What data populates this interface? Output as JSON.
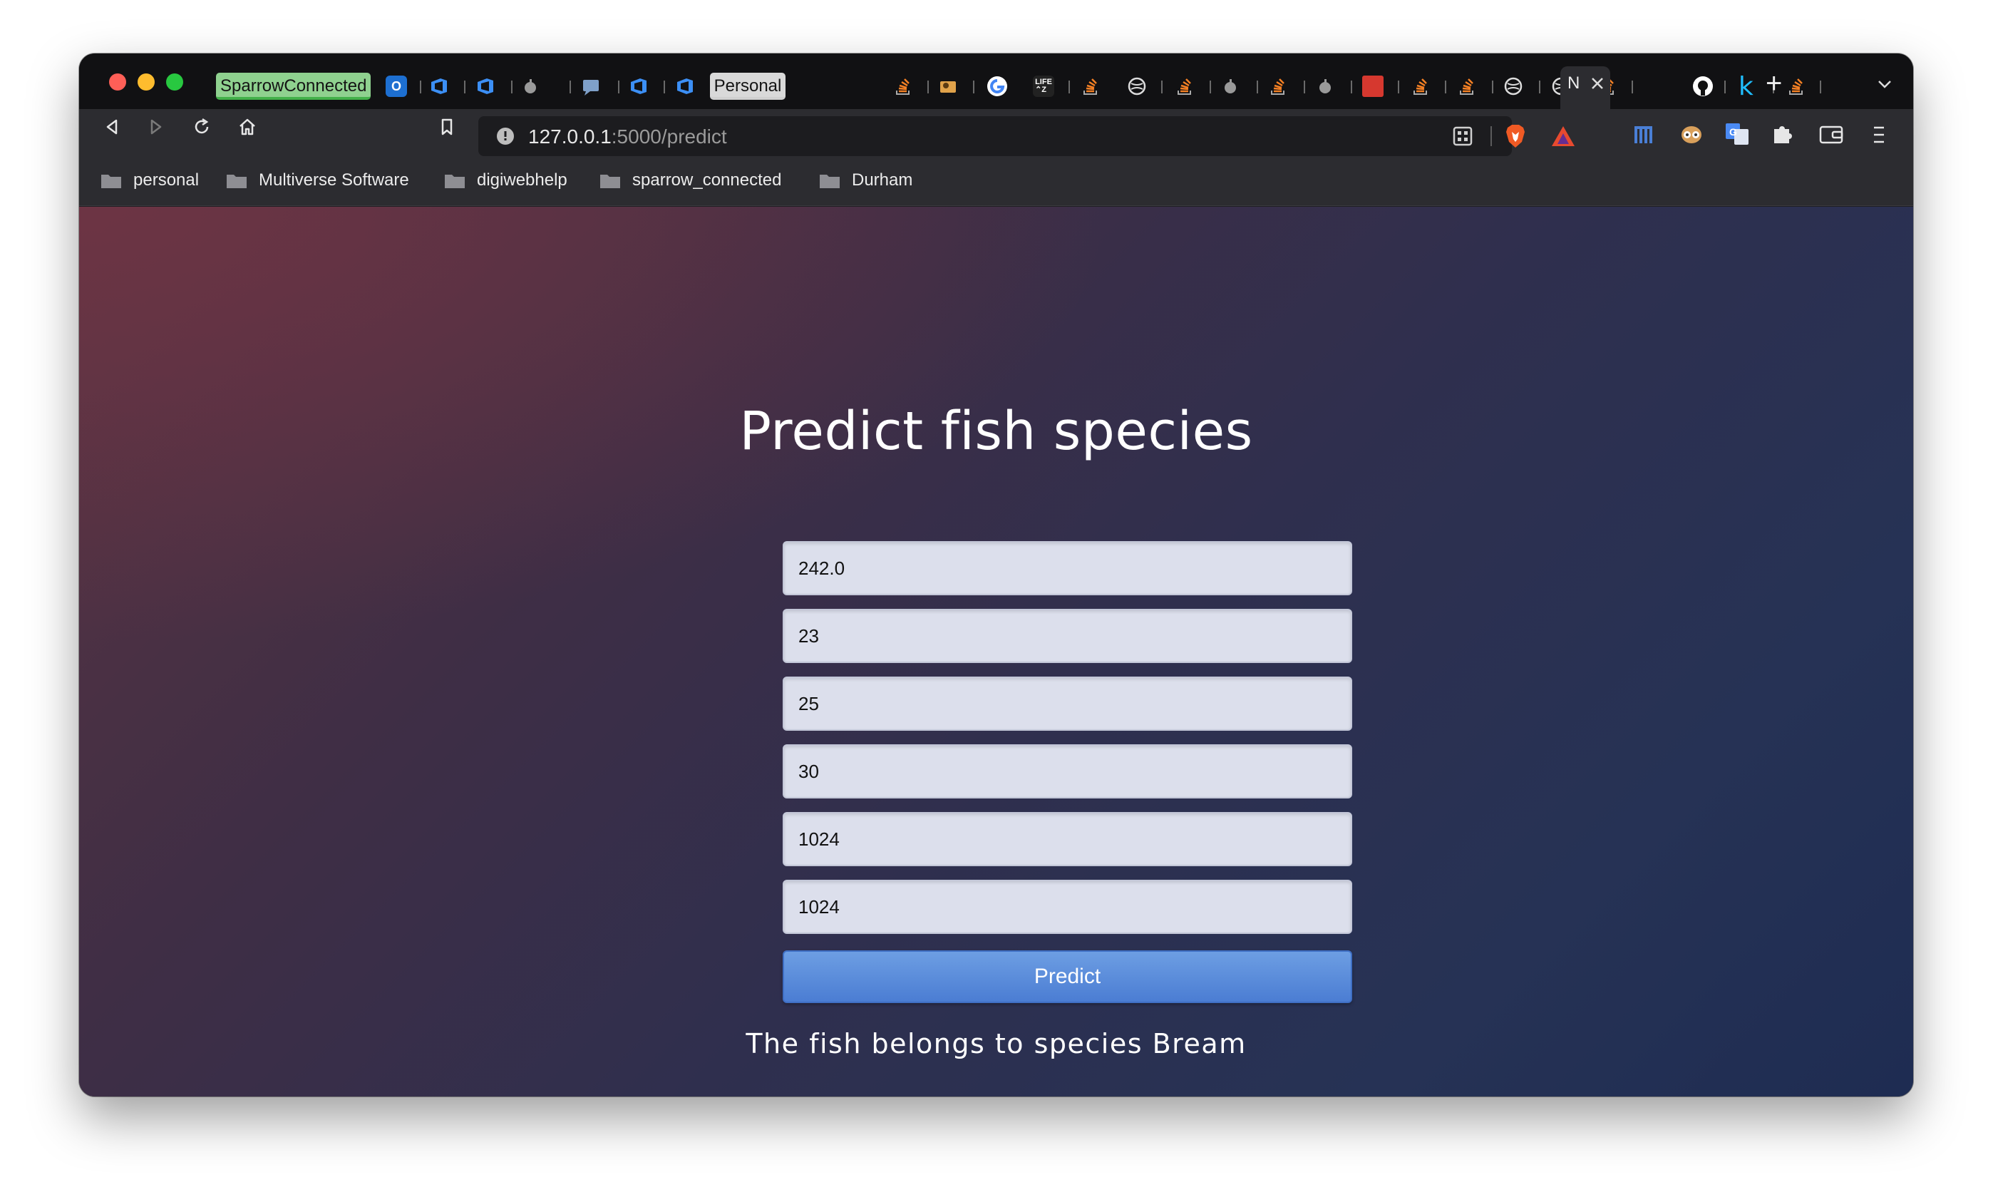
{
  "browser": {
    "tabs": {
      "group_sparrow": "SparrowConnected",
      "group_personal": "Personal",
      "active_tab_partial": "N",
      "new_tab_symbol": "+"
    },
    "address_bar": {
      "host": "127.0.0.1",
      "path": ":5000/predict"
    },
    "bookmarks": [
      "personal",
      "Multiverse Software",
      "digiwebhelp",
      "sparrow_connected",
      "Durham"
    ],
    "icons": {
      "back": "back-arrow-icon",
      "forward": "forward-arrow-icon",
      "reload": "reload-icon",
      "home": "home-icon",
      "bookmark": "bookmark-icon",
      "site_info": "info-icon",
      "brave_shield": "brave-shield-icon",
      "rewards": "brave-rewards-icon",
      "extensions": "puzzle-icon",
      "wallet": "wallet-icon",
      "menu": "hamburger-menu-icon"
    }
  },
  "page": {
    "title": "Predict fish species",
    "fields": [
      {
        "value": "242.0"
      },
      {
        "value": "23"
      },
      {
        "value": "25"
      },
      {
        "value": "30"
      },
      {
        "value": "1024"
      },
      {
        "value": "1024"
      }
    ],
    "submit_label": "Predict",
    "result": "The fish belongs to species Bream"
  },
  "colors": {
    "button_top": "#6d9ee3",
    "button_bottom": "#4b7dd3",
    "sparrow_tab_group": "#8fd18f",
    "input_bg": "#dcdfec"
  }
}
